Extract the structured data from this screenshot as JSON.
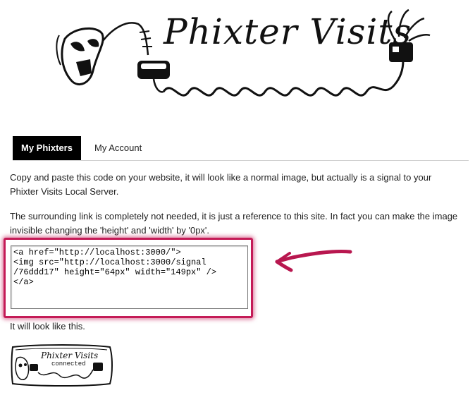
{
  "header": {
    "logo_text": "Phixter Visits"
  },
  "tabs": [
    {
      "label": "My Phixters",
      "active": true
    },
    {
      "label": "My Account",
      "active": false
    }
  ],
  "content": {
    "instructions_1": "Copy and paste this code on your website, it will look like a normal image, but actually is a signal to your Phixter Visits Local Server.",
    "instructions_2": "The surrounding link is completely not needed, it is just a reference to this site. In fact you can make the image invisible changing the 'height' and 'width' by '0px'.",
    "embed_code": "<a href=\"http://localhost:3000/\">\n<img src=\"http://localhost:3000/signal\n/76ddd17\" height=\"64px\" width=\"149px\" />\n</a>",
    "preview_label": "It will look like this."
  },
  "badge": {
    "title": "Phixter Visits",
    "status": "connected"
  },
  "colors": {
    "highlight": "#c41b57",
    "tab_active_bg": "#000000",
    "tab_active_text": "#ffffff"
  }
}
